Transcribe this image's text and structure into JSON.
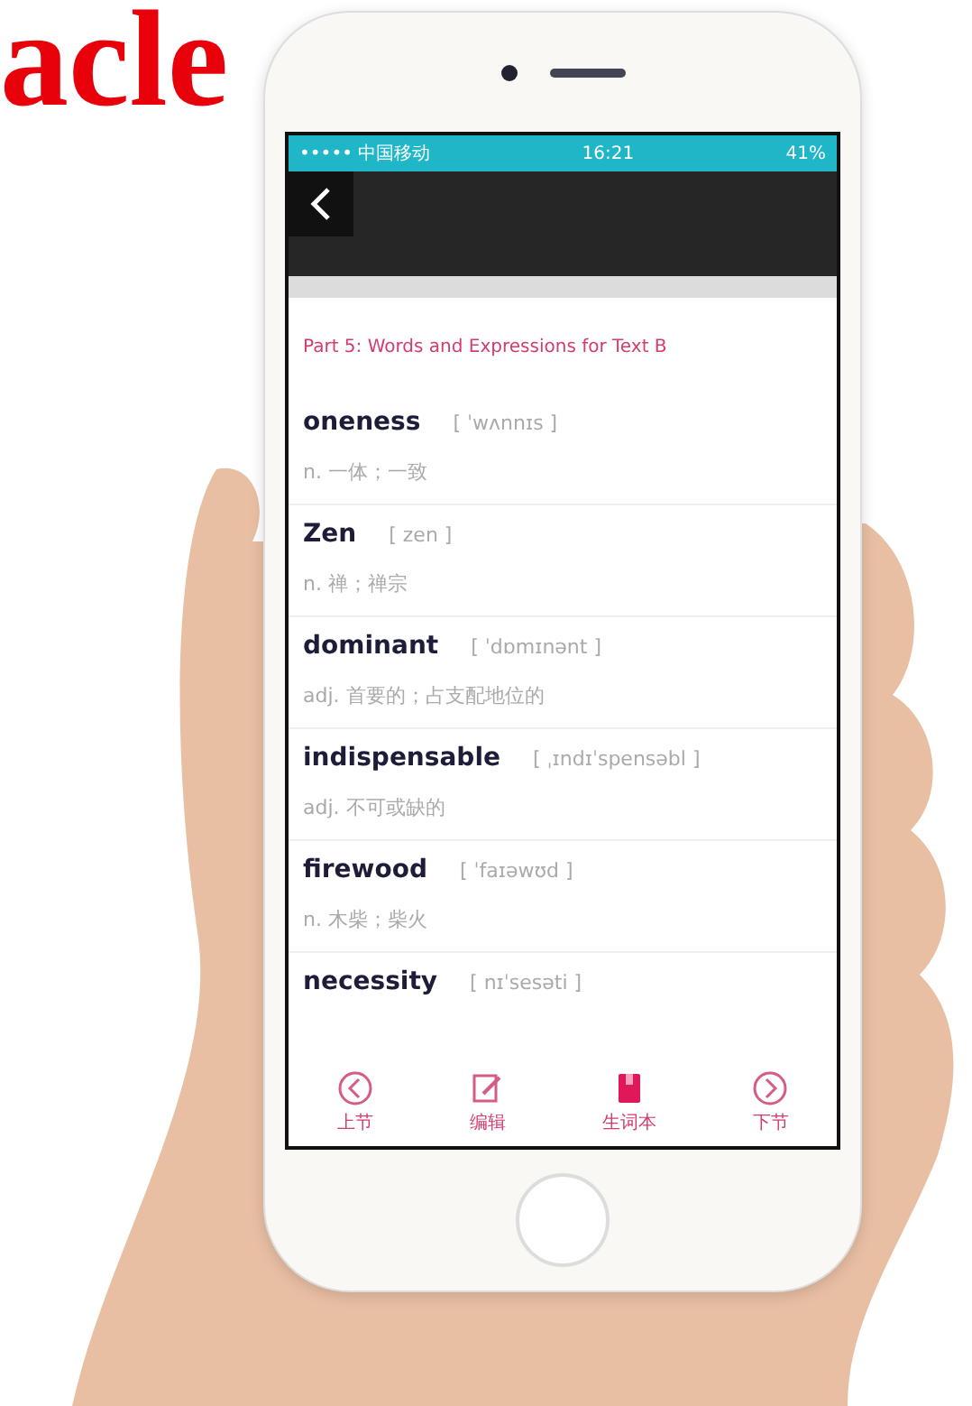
{
  "slide_title": "acle",
  "status_bar": {
    "carrier": "••••• 中国移动",
    "time": "16:21",
    "battery": "41%"
  },
  "section_title": "Part 5: Words and Expressions for Text B",
  "words": [
    {
      "word": "oneness",
      "phonetic": "[ ˈwʌnnɪs ]",
      "meaning": "n. 一体；一致"
    },
    {
      "word": "Zen",
      "phonetic": "[ zen ]",
      "meaning": "n. 禅；禅宗"
    },
    {
      "word": "dominant",
      "phonetic": "[ ˈdɒmɪnənt ]",
      "meaning": "adj. 首要的；占支配地位的"
    },
    {
      "word": "indispensable",
      "phonetic": "[ ˌɪndɪˈspensəbl ]",
      "meaning": "adj. 不可或缺的"
    },
    {
      "word": "firewood",
      "phonetic": "[ ˈfaɪəwʊd ]",
      "meaning": "n. 木柴；柴火"
    },
    {
      "word": "necessity",
      "phonetic": "[ nɪˈsesəti ]"
    }
  ],
  "toolbar": [
    {
      "kind": "prev",
      "label": "上节"
    },
    {
      "kind": "edit",
      "label": "编辑"
    },
    {
      "kind": "book",
      "label": "生词本"
    },
    {
      "kind": "next",
      "label": "下节"
    }
  ]
}
